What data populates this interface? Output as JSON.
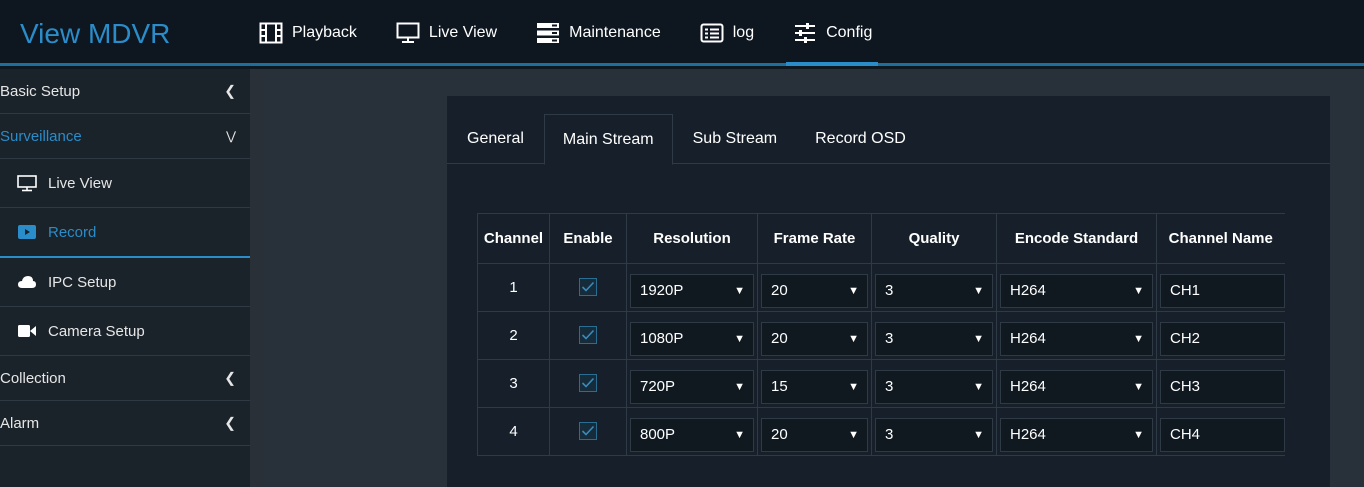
{
  "app": {
    "title": "View MDVR"
  },
  "nav": [
    {
      "label": "Playback",
      "icon": "film-icon",
      "active": false
    },
    {
      "label": "Live View",
      "icon": "monitor-icon",
      "active": false
    },
    {
      "label": "Maintenance",
      "icon": "server-icon",
      "active": false
    },
    {
      "label": "log",
      "icon": "list-icon",
      "active": false
    },
    {
      "label": "Config",
      "icon": "sliders-icon",
      "active": true
    }
  ],
  "sidebar": {
    "basic_setup": "Basic Setup",
    "surveillance": "Surveillance",
    "live_view": "Live View",
    "record": "Record",
    "ipc_setup": "IPC Setup",
    "camera_setup": "Camera Setup",
    "collection": "Collection",
    "alarm": "Alarm"
  },
  "tabs": {
    "general": "General",
    "main_stream": "Main Stream",
    "sub_stream": "Sub Stream",
    "record_osd": "Record OSD"
  },
  "table": {
    "headers": {
      "channel": "Channel",
      "enable": "Enable",
      "resolution": "Resolution",
      "frame_rate": "Frame Rate",
      "quality": "Quality",
      "encode_standard": "Encode Standard",
      "channel_name": "Channel Name"
    },
    "rows": [
      {
        "channel": "1",
        "enable": true,
        "resolution": "1920P",
        "frame_rate": "20",
        "quality": "3",
        "encode": "H264",
        "name": "CH1"
      },
      {
        "channel": "2",
        "enable": true,
        "resolution": "1080P",
        "frame_rate": "20",
        "quality": "3",
        "encode": "H264",
        "name": "CH2"
      },
      {
        "channel": "3",
        "enable": true,
        "resolution": "720P",
        "frame_rate": "15",
        "quality": "3",
        "encode": "H264",
        "name": "CH3"
      },
      {
        "channel": "4",
        "enable": true,
        "resolution": "800P",
        "frame_rate": "20",
        "quality": "3",
        "encode": "H264",
        "name": "CH4"
      }
    ]
  },
  "colors": {
    "accent": "#2a8cc8",
    "background": "#0f171f",
    "panel": "#17202a"
  }
}
